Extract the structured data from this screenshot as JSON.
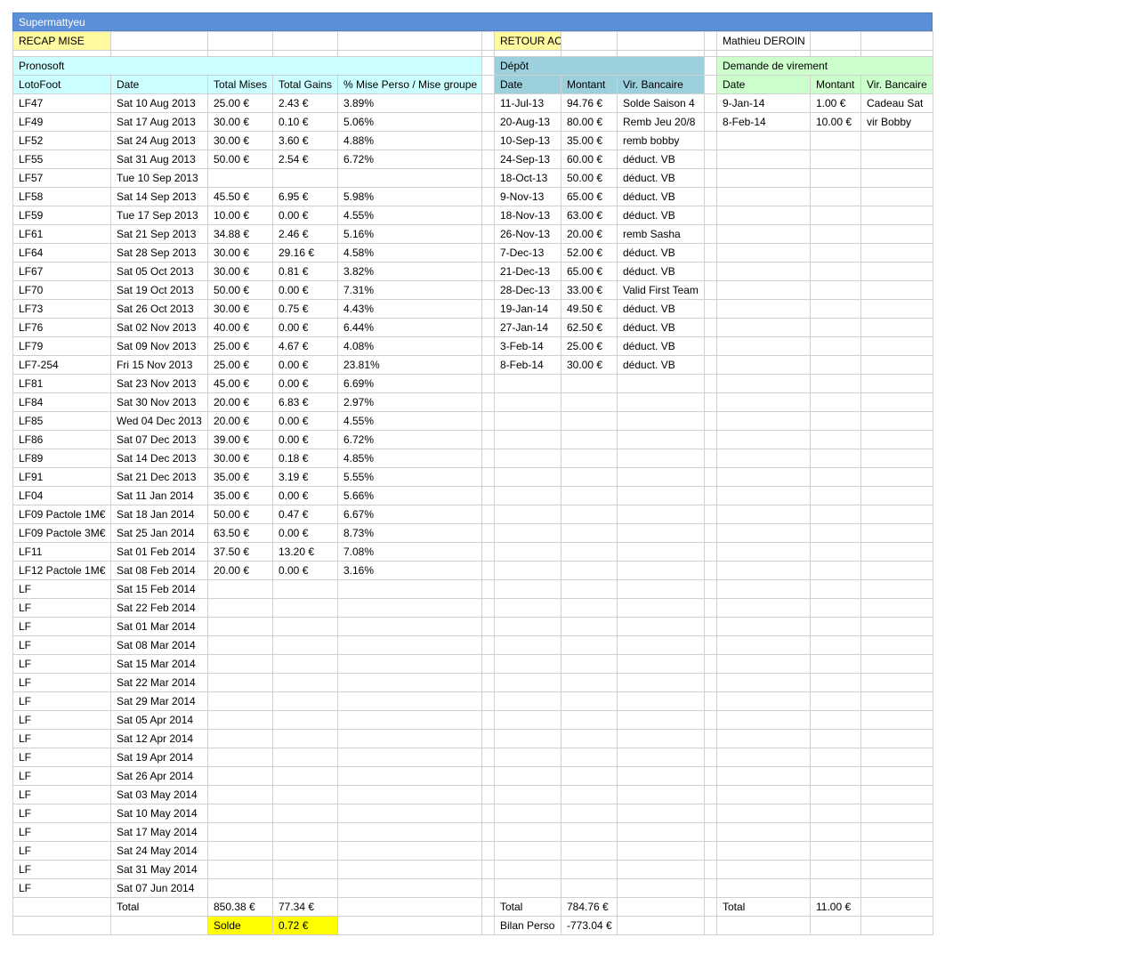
{
  "sheet_title": "Supermattyeu",
  "top_links": {
    "recap": "RECAP MISE",
    "accueil": "RETOUR ACCUEIL",
    "user": "Mathieu DEROIN"
  },
  "sections": {
    "pronosoft": "Pronosoft",
    "depot": "Dépôt",
    "virement": "Demande de virement"
  },
  "headers": {
    "pronosoft": [
      "LotoFoot",
      "Date",
      "Total Mises",
      "Total Gains",
      "% Mise Perso / Mise groupe"
    ],
    "depot": [
      "Date",
      "Montant",
      "Vir. Bancaire"
    ],
    "virement": [
      "Date",
      "Montant",
      "Vir. Bancaire"
    ]
  },
  "pronosoft_rows": [
    [
      "LF47",
      "Sat 10 Aug 2013",
      "25.00 €",
      "2.43 €",
      "3.89%"
    ],
    [
      "LF49",
      "Sat 17 Aug 2013",
      "30.00 €",
      "0.10 €",
      "5.06%"
    ],
    [
      "LF52",
      "Sat 24 Aug 2013",
      "30.00 €",
      "3.60 €",
      "4.88%"
    ],
    [
      "LF55",
      "Sat 31 Aug 2013",
      "50.00 €",
      "2.54 €",
      "6.72%"
    ],
    [
      "LF57",
      "Tue 10 Sep 2013",
      "",
      "",
      ""
    ],
    [
      "LF58",
      "Sat 14 Sep 2013",
      "45.50 €",
      "6.95 €",
      "5.98%"
    ],
    [
      "LF59",
      "Tue 17 Sep 2013",
      "10.00 €",
      "0.00 €",
      "4.55%"
    ],
    [
      "LF61",
      "Sat 21 Sep 2013",
      "34.88 €",
      "2.46 €",
      "5.16%"
    ],
    [
      "LF64",
      "Sat 28 Sep 2013",
      "30.00 €",
      "29.16 €",
      "4.58%"
    ],
    [
      "LF67",
      "Sat 05 Oct 2013",
      "30.00 €",
      "0.81 €",
      "3.82%"
    ],
    [
      "LF70",
      "Sat 19 Oct 2013",
      "50.00 €",
      "0.00 €",
      "7.31%"
    ],
    [
      "LF73",
      "Sat 26 Oct 2013",
      "30.00 €",
      "0.75 €",
      "4.43%"
    ],
    [
      "LF76",
      "Sat 02 Nov 2013",
      "40.00 €",
      "0.00 €",
      "6.44%"
    ],
    [
      "LF79",
      "Sat 09 Nov 2013",
      "25.00 €",
      "4.67 €",
      "4.08%"
    ],
    [
      "LF7-254",
      "Fri 15 Nov 2013",
      "25.00 €",
      "0.00 €",
      "23.81%"
    ],
    [
      "LF81",
      "Sat 23 Nov 2013",
      "45.00 €",
      "0.00 €",
      "6.69%"
    ],
    [
      "LF84",
      "Sat 30 Nov 2013",
      "20.00 €",
      "6.83 €",
      "2.97%"
    ],
    [
      "LF85",
      "Wed 04 Dec 2013",
      "20.00 €",
      "0.00 €",
      "4.55%"
    ],
    [
      "LF86",
      "Sat 07 Dec 2013",
      "39.00 €",
      "0.00 €",
      "6.72%"
    ],
    [
      "LF89",
      "Sat 14 Dec 2013",
      "30.00 €",
      "0.18 €",
      "4.85%"
    ],
    [
      "LF91",
      "Sat 21 Dec 2013",
      "35.00 €",
      "3.19 €",
      "5.55%"
    ],
    [
      "LF04",
      "Sat 11 Jan 2014",
      "35.00 €",
      "0.00 €",
      "5.66%"
    ],
    [
      "LF09 Pactole 1M€",
      "Sat 18 Jan 2014",
      "50.00 €",
      "0.47 €",
      "6.67%"
    ],
    [
      "LF09 Pactole 3M€",
      "Sat 25 Jan 2014",
      "63.50 €",
      "0.00 €",
      "8.73%"
    ],
    [
      "LF11",
      "Sat 01 Feb 2014",
      "37.50 €",
      "13.20 €",
      "7.08%"
    ],
    [
      "LF12 Pactole 1M€",
      "Sat 08 Feb 2014",
      "20.00 €",
      "0.00 €",
      "3.16%"
    ],
    [
      "LF",
      "Sat 15 Feb 2014",
      "",
      "",
      ""
    ],
    [
      "LF",
      "Sat 22 Feb 2014",
      "",
      "",
      ""
    ],
    [
      "LF",
      "Sat 01 Mar 2014",
      "",
      "",
      ""
    ],
    [
      "LF",
      "Sat 08 Mar 2014",
      "",
      "",
      ""
    ],
    [
      "LF",
      "Sat 15 Mar 2014",
      "",
      "",
      ""
    ],
    [
      "LF",
      "Sat 22 Mar 2014",
      "",
      "",
      ""
    ],
    [
      "LF",
      "Sat 29 Mar 2014",
      "",
      "",
      ""
    ],
    [
      "LF",
      "Sat 05 Apr 2014",
      "",
      "",
      ""
    ],
    [
      "LF",
      "Sat 12 Apr 2014",
      "",
      "",
      ""
    ],
    [
      "LF",
      "Sat 19 Apr 2014",
      "",
      "",
      ""
    ],
    [
      "LF",
      "Sat 26 Apr 2014",
      "",
      "",
      ""
    ],
    [
      "LF",
      "Sat 03 May 2014",
      "",
      "",
      ""
    ],
    [
      "LF",
      "Sat 10 May 2014",
      "",
      "",
      ""
    ],
    [
      "LF",
      "Sat 17 May 2014",
      "",
      "",
      ""
    ],
    [
      "LF",
      "Sat 24 May 2014",
      "",
      "",
      ""
    ],
    [
      "LF",
      "Sat 31 May 2014",
      "",
      "",
      ""
    ],
    [
      "LF",
      "Sat 07 Jun 2014",
      "",
      "",
      ""
    ]
  ],
  "depot_rows": [
    [
      "11-Jul-13",
      "94.76 €",
      "Solde Saison 4"
    ],
    [
      "20-Aug-13",
      "80.00 €",
      "Remb Jeu 20/8"
    ],
    [
      "10-Sep-13",
      "35.00 €",
      "remb bobby"
    ],
    [
      "24-Sep-13",
      "60.00 €",
      "déduct. VB"
    ],
    [
      "18-Oct-13",
      "50.00 €",
      "déduct. VB"
    ],
    [
      "9-Nov-13",
      "65.00 €",
      "déduct. VB"
    ],
    [
      "18-Nov-13",
      "63.00 €",
      "déduct. VB"
    ],
    [
      "26-Nov-13",
      "20.00 €",
      "remb Sasha"
    ],
    [
      "7-Dec-13",
      "52.00 €",
      "déduct. VB"
    ],
    [
      "21-Dec-13",
      "65.00 €",
      "déduct. VB"
    ],
    [
      "28-Dec-13",
      "33.00 €",
      "Valid First Team"
    ],
    [
      "19-Jan-14",
      "49.50 €",
      "déduct. VB"
    ],
    [
      "27-Jan-14",
      "62.50 €",
      "déduct. VB"
    ],
    [
      "3-Feb-14",
      "25.00 €",
      "déduct. VB"
    ],
    [
      "8-Feb-14",
      "30.00 €",
      "déduct. VB"
    ]
  ],
  "virement_rows": [
    [
      "9-Jan-14",
      "1.00 €",
      "Cadeau Sat"
    ],
    [
      "8-Feb-14",
      "10.00 €",
      "vir Bobby"
    ]
  ],
  "totals": {
    "label": "Total",
    "mises": "850.38 €",
    "gains": "77.34 €",
    "solde_label": "Solde",
    "solde": "0.72 €",
    "depot_label": "Total",
    "depot_total": "784.76 €",
    "bilan_label": "Bilan Perso",
    "bilan": "-773.04 €",
    "vir_label": "Total",
    "vir_total": "11.00 €"
  }
}
